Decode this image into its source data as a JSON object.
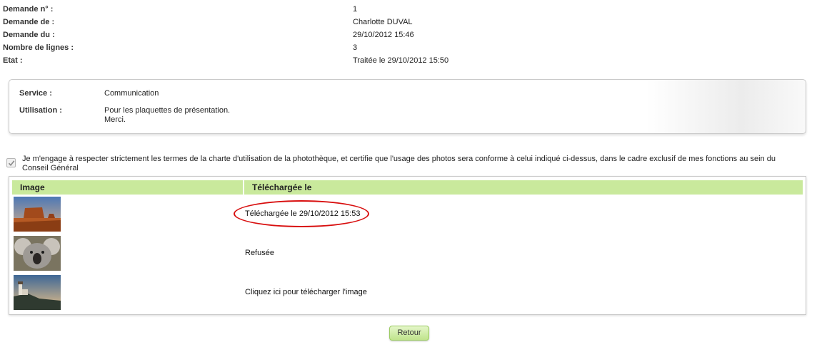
{
  "request_info": [
    {
      "label": "Demande n° :",
      "value": "1"
    },
    {
      "label": "Demande de :",
      "value": "Charlotte DUVAL"
    },
    {
      "label": "Demande du :",
      "value": "29/10/2012 15:46"
    },
    {
      "label": "Nombre de lignes :",
      "value": "3"
    },
    {
      "label": "Etat :",
      "value": "Traitée le 29/10/2012 15:50"
    }
  ],
  "service_box": {
    "service_label": "Service :",
    "service_value": "Communication",
    "usage_label": "Utilisation :",
    "usage_line1": "Pour les plaquettes de présentation.",
    "usage_line2": "Merci."
  },
  "engagement": {
    "checked": true,
    "text": "Je m'engage à respecter strictement les termes de la charte d'utilisation de la photothèque, et certifie que l'usage des photos sera conforme à celui indiqué ci-dessus, dans le cadre exclusif de mes fonctions au sein du Conseil Général"
  },
  "table": {
    "headers": [
      "Image",
      "Téléchargée le"
    ],
    "rows": [
      {
        "image": "desert-mesa-photo",
        "status": "Téléchargée le 29/10/2012 15:53"
      },
      {
        "image": "koala-photo",
        "status": "Refusée"
      },
      {
        "image": "lighthouse-photo",
        "status": "Cliquez ici pour télécharger l'image"
      }
    ]
  },
  "annotation": {
    "color": "#d80f0f",
    "shape": "ellipse"
  },
  "back_button": "Retour",
  "colors": {
    "header_green": "#c9e99c",
    "button_green": "#c0e48c",
    "border_gray": "#c9c9c9"
  }
}
